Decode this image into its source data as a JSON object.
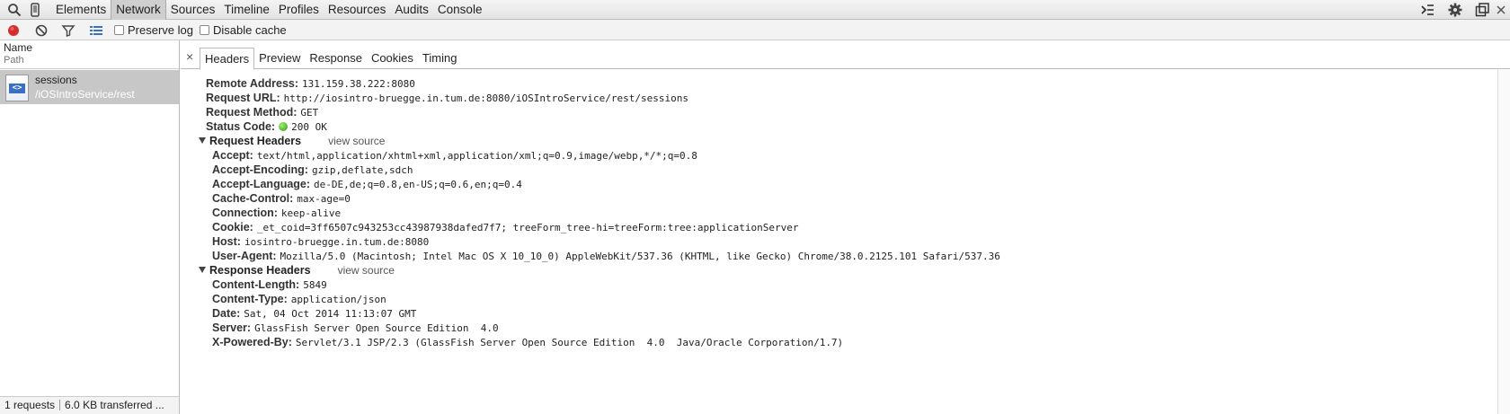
{
  "toolbar": {
    "tabs": [
      "Elements",
      "Network",
      "Sources",
      "Timeline",
      "Profiles",
      "Resources",
      "Audits",
      "Console"
    ]
  },
  "subbar": {
    "preserve_log": "Preserve log",
    "disable_cache": "Disable cache"
  },
  "requests": {
    "header_name": "Name",
    "header_path": "Path",
    "items": [
      {
        "name": "sessions",
        "path": "/iOSIntroService/rest"
      }
    ],
    "footer_count": "1 requests",
    "footer_transferred": "6.0 KB transferred ..."
  },
  "detail": {
    "close": "×",
    "tabs": [
      "Headers",
      "Preview",
      "Response",
      "Cookies",
      "Timing"
    ],
    "general": [
      {
        "key": "Remote Address:",
        "value": "131.159.38.222:8080"
      },
      {
        "key": "Request URL:",
        "value": "http://iosintro-bruegge.in.tum.de:8080/iOSIntroService/rest/sessions"
      },
      {
        "key": "Request Method:",
        "value": "GET"
      },
      {
        "key": "Status Code:",
        "value": "200 OK"
      }
    ],
    "request_headers_title": "Request Headers",
    "view_source": "view source",
    "request_headers": [
      {
        "key": "Accept:",
        "value": "text/html,application/xhtml+xml,application/xml;q=0.9,image/webp,*/*;q=0.8"
      },
      {
        "key": "Accept-Encoding:",
        "value": "gzip,deflate,sdch"
      },
      {
        "key": "Accept-Language:",
        "value": "de-DE,de;q=0.8,en-US;q=0.6,en;q=0.4"
      },
      {
        "key": "Cache-Control:",
        "value": "max-age=0"
      },
      {
        "key": "Connection:",
        "value": "keep-alive"
      },
      {
        "key": "Cookie:",
        "value": "_et_coid=3ff6507c943253cc43987938dafed7f7; treeForm_tree-hi=treeForm:tree:applicationServer"
      },
      {
        "key": "Host:",
        "value": "iosintro-bruegge.in.tum.de:8080"
      },
      {
        "key": "User-Agent:",
        "value": "Mozilla/5.0 (Macintosh; Intel Mac OS X 10_10_0) AppleWebKit/537.36 (KHTML, like Gecko) Chrome/38.0.2125.101 Safari/537.36"
      }
    ],
    "response_headers_title": "Response Headers",
    "response_headers": [
      {
        "key": "Content-Length:",
        "value": "5849"
      },
      {
        "key": "Content-Type:",
        "value": "application/json"
      },
      {
        "key": "Date:",
        "value": "Sat, 04 Oct 2014 11:13:07 GMT"
      },
      {
        "key": "Server:",
        "value": "GlassFish Server Open Source Edition  4.0"
      },
      {
        "key": "X-Powered-By:",
        "value": "Servlet/3.1 JSP/2.3 (GlassFish Server Open Source Edition  4.0  Java/Oracle Corporation/1.7)"
      }
    ]
  },
  "colors": {
    "record": "#d32f2f",
    "status_ok": "#3cb521",
    "selected_row": "#c7c7c7"
  }
}
